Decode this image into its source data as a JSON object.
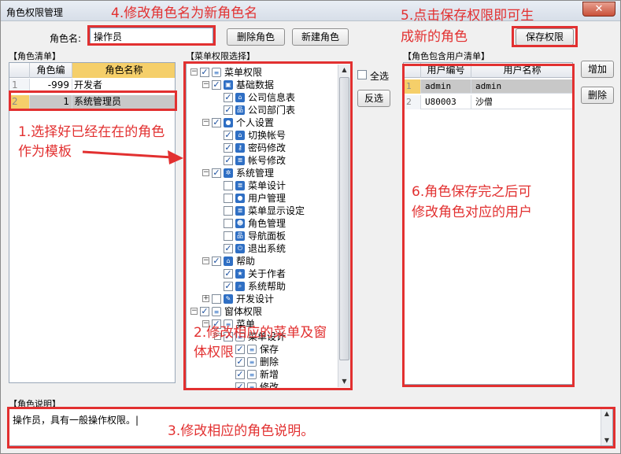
{
  "window": {
    "title": "角色权限管理",
    "close_label": "✕"
  },
  "role_name": {
    "label": "角色名:",
    "value": "操作员"
  },
  "buttons": {
    "delete_role": "删除角色",
    "new_role": "新建角色",
    "save_permissions": "保存权限",
    "select_all": "全选",
    "invert": "反选",
    "add": "增加",
    "remove": "删除"
  },
  "role_list": {
    "title": "【角色清单】",
    "columns": [
      "角色编",
      "角色名称"
    ],
    "rows": [
      {
        "num": "1",
        "code": "-999",
        "name": "开发者"
      },
      {
        "num": "2",
        "code": "1",
        "name": "系统管理员"
      }
    ]
  },
  "menu_tree": {
    "title": "【菜单权限选择】",
    "nodes": [
      {
        "label": "菜单权限",
        "level": 0,
        "expander": "−",
        "checked": true,
        "icon": "doc"
      },
      {
        "label": "基础数据",
        "level": 1,
        "expander": "−",
        "checked": true,
        "icon": "folder"
      },
      {
        "label": "公司信息表",
        "level": 2,
        "expander": "",
        "checked": true,
        "icon": "home"
      },
      {
        "label": "公司部门表",
        "level": 2,
        "expander": "",
        "checked": true,
        "icon": "tree"
      },
      {
        "label": "个人设置",
        "level": 1,
        "expander": "−",
        "checked": true,
        "icon": "user"
      },
      {
        "label": "切换帐号",
        "level": 2,
        "expander": "",
        "checked": true,
        "icon": "home"
      },
      {
        "label": "密码修改",
        "level": 2,
        "expander": "",
        "checked": true,
        "icon": "key"
      },
      {
        "label": "帐号修改",
        "level": 2,
        "expander": "",
        "checked": true,
        "icon": "list"
      },
      {
        "label": "系统管理",
        "level": 1,
        "expander": "−",
        "checked": true,
        "icon": "gear"
      },
      {
        "label": "菜单设计",
        "level": 2,
        "expander": "",
        "checked": false,
        "icon": "list"
      },
      {
        "label": "用户管理",
        "level": 2,
        "expander": "",
        "checked": false,
        "icon": "user"
      },
      {
        "label": "菜单显示设定",
        "level": 2,
        "expander": "",
        "checked": false,
        "icon": "list"
      },
      {
        "label": "角色管理",
        "level": 2,
        "expander": "",
        "checked": false,
        "icon": "users"
      },
      {
        "label": "导航面板",
        "level": 2,
        "expander": "",
        "checked": false,
        "icon": "tree"
      },
      {
        "label": "退出系统",
        "level": 2,
        "expander": "",
        "checked": true,
        "icon": "power"
      },
      {
        "label": "帮助",
        "level": 1,
        "expander": "−",
        "checked": true,
        "icon": "home"
      },
      {
        "label": "关于作者",
        "level": 2,
        "expander": "",
        "checked": true,
        "icon": "star"
      },
      {
        "label": "系统帮助",
        "level": 2,
        "expander": "",
        "checked": true,
        "icon": "search"
      },
      {
        "label": "开发设计",
        "level": 1,
        "expander": "+",
        "checked": false,
        "icon": "wrench"
      },
      {
        "label": "窗体权限",
        "level": 0,
        "expander": "−",
        "checked": true,
        "icon": "doc"
      },
      {
        "label": "菜单",
        "level": 1,
        "expander": "−",
        "checked": true,
        "icon": "doc"
      },
      {
        "label": "菜单设计",
        "level": 2,
        "expander": "−",
        "checked": true,
        "icon": "doc"
      },
      {
        "label": "保存",
        "level": 3,
        "expander": "",
        "checked": true,
        "icon": "doc"
      },
      {
        "label": "删除",
        "level": 3,
        "expander": "",
        "checked": true,
        "icon": "doc"
      },
      {
        "label": "新增",
        "level": 3,
        "expander": "",
        "checked": true,
        "icon": "doc"
      },
      {
        "label": "修改",
        "level": 3,
        "expander": "",
        "checked": true,
        "icon": "doc"
      }
    ]
  },
  "user_list": {
    "title": "【角色包含用户清单】",
    "columns": [
      "用户编号",
      "用户名称"
    ],
    "rows": [
      {
        "num": "1",
        "code": "admin",
        "name": "admin"
      },
      {
        "num": "2",
        "code": "U80003",
        "name": "沙僧"
      }
    ]
  },
  "description": {
    "title": "【角色说明】",
    "value": "操作员，具有一般操作权限。|"
  },
  "annotations": [
    "4.修改角色名为新角色名",
    "5.点击保存权限即可生",
    "成新的角色",
    "1.选择好已经在在的角色",
    "作为模板",
    "2.修改相应的菜单及窗",
    "体权限",
    "6.角色保存完之后可",
    "修改角色对应的用户",
    "3.修改相应的角色说明。"
  ],
  "icons": {
    "doc": "≡",
    "folder": "▣",
    "home": "⌂",
    "tree": "品",
    "user": "●",
    "key": "⚷",
    "list": "≣",
    "gear": "✲",
    "users": "☻",
    "power": "⏻",
    "star": "★",
    "search": "⌕",
    "wrench": "✎"
  },
  "colors": {
    "annotation": "#e23030",
    "header_accent": "#f5cf6a",
    "selected_row": "#c8c8c8"
  }
}
